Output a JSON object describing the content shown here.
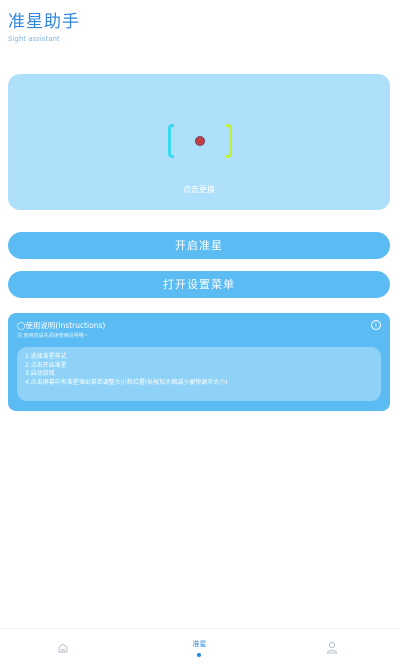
{
  "header": {
    "title": "准星助手",
    "subtitle": "Sight assistant"
  },
  "preview": {
    "hint": "点击更换"
  },
  "buttons": {
    "open_crosshair": "开启准星",
    "open_settings": "打开设置菜单"
  },
  "instructions": {
    "title": "◯使用说明(Instructions)",
    "subtitle": "注:使用前请先阅读使用说明哦~",
    "steps": [
      "1.选择准星样式",
      "2.点击开启准星",
      "3.启动游戏",
      "4.点击屏幕中央准星弹出菜单调整大小和位置(长按加大缩减小便快调节大小)"
    ]
  },
  "bottom_nav": {
    "center_label": "准星"
  },
  "colors": {
    "accent": "#5bbcf3",
    "preview_bg": "#aee0fb",
    "title": "#2e86de"
  }
}
